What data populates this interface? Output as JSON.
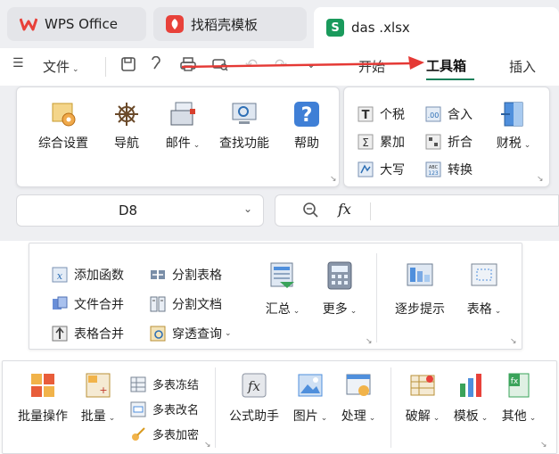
{
  "tabs": [
    {
      "label": "WPS Office",
      "icon": "wps-logo-icon"
    },
    {
      "label": "找稻壳模板",
      "icon": "docer-icon"
    },
    {
      "label": "das .xlsx",
      "icon": "spreadsheet-s-icon"
    }
  ],
  "menubar": {
    "file_label": "文件",
    "tabs": [
      "开始",
      "工具箱",
      "插入"
    ],
    "active_tab": "工具箱"
  },
  "ribbon1": {
    "large": [
      "综合设置",
      "导航",
      "邮件",
      "查找功能",
      "帮助"
    ],
    "small": [
      "个税",
      "累加",
      "大写",
      "含入",
      "折合",
      "转换"
    ],
    "finance": "财税"
  },
  "formula_bar": {
    "cell_ref": "D8",
    "fx": "fx"
  },
  "ribbon2": {
    "small_col1": [
      "添加函数",
      "文件合并",
      "表格合并"
    ],
    "small_col2": [
      "分割表格",
      "分割文档",
      "穿透查询"
    ],
    "large": [
      "汇总",
      "更多",
      "逐步提示",
      "表格"
    ]
  },
  "ribbon3": {
    "large_left": [
      "批量操作",
      "批量"
    ],
    "small": [
      "多表冻结",
      "多表改名",
      "多表加密"
    ],
    "large_right": [
      "公式助手",
      "图片",
      "处理",
      "破解",
      "模板",
      "其他"
    ]
  },
  "colors": {
    "accent": "#1a7f5a",
    "arrow": "#e53935",
    "wps_red": "#e8413a",
    "sheet_green": "#1a9a5c"
  }
}
